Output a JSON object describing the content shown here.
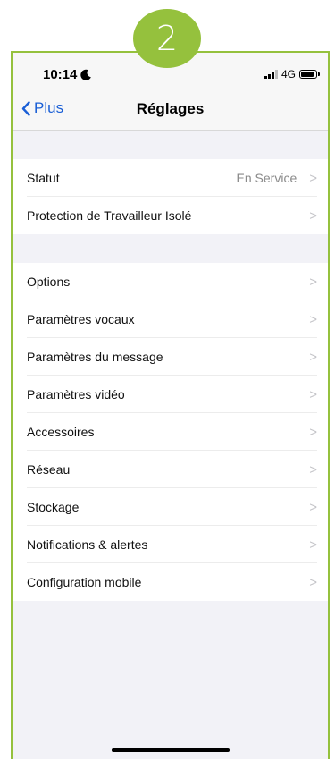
{
  "badge": {
    "step": "2"
  },
  "status_bar": {
    "time": "10:14",
    "network": "4G",
    "moon_icon": "moon-icon",
    "signal_icon": "cellular-signal-icon",
    "battery_icon": "battery-icon"
  },
  "nav": {
    "back_label": "Plus",
    "title": "Réglages",
    "back_icon": "chevron-left-icon"
  },
  "group1": [
    {
      "label": "Statut",
      "value": "En Service"
    },
    {
      "label": "Protection de Travailleur Isolé",
      "value": ""
    }
  ],
  "group2": [
    {
      "label": "Options"
    },
    {
      "label": "Paramètres vocaux"
    },
    {
      "label": "Paramètres du message"
    },
    {
      "label": "Paramètres vidéo"
    },
    {
      "label": "Accessoires"
    },
    {
      "label": "Réseau"
    },
    {
      "label": "Stockage"
    },
    {
      "label": "Notifications & alertes"
    },
    {
      "label": "Configuration mobile"
    }
  ],
  "chevron": ">",
  "colors": {
    "accent": "#95c13d",
    "link": "#1a5fd6",
    "background": "#f2f2f7"
  }
}
